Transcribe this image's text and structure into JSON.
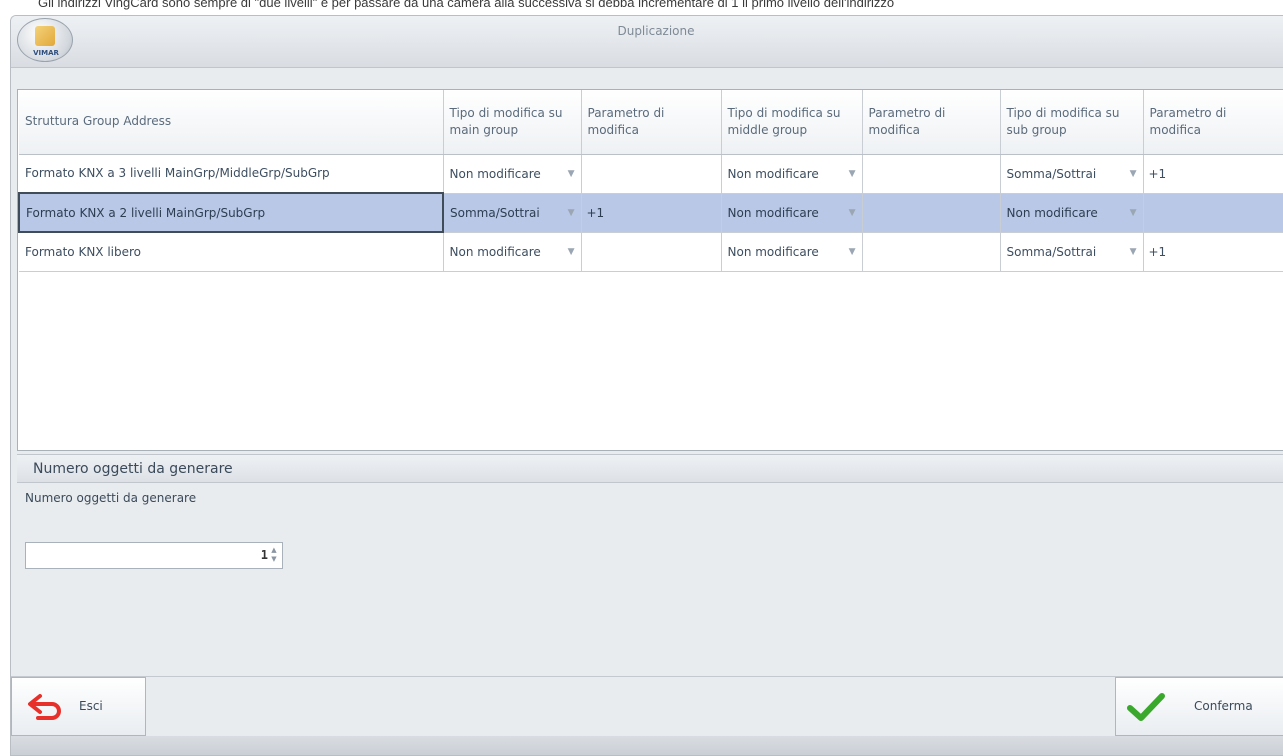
{
  "document_text": "Gli indirizzi VingCard sono sempre di \"due livelli\" e per passare da una camera alla successiva si debba incrementare di 1 il primo livello dell'indirizzo",
  "dialog": {
    "title": "Duplicazione",
    "logo_text": "VIMAR"
  },
  "table": {
    "headers": [
      "Struttura Group Address",
      "Tipo di modifica su main group",
      "Parametro di modifica",
      "Tipo di modifica su middle group",
      "Parametro di modifica",
      "Tipo di modifica su sub group",
      "Parametro di modifica"
    ],
    "rows": [
      {
        "structure": "Formato KNX a 3 livelli MainGrp/MiddleGrp/SubGrp",
        "main_type": "Non modificare",
        "main_param": "",
        "middle_type": "Non modificare",
        "middle_param": "",
        "sub_type": "Somma/Sottrai",
        "sub_param": "+1"
      },
      {
        "structure": "Formato KNX a 2 livelli MainGrp/SubGrp",
        "main_type": "Somma/Sottrai",
        "main_param": "+1",
        "middle_type": "Non modificare",
        "middle_param": "",
        "sub_type": "Non modificare",
        "sub_param": "",
        "selected": true
      },
      {
        "structure": "Formato KNX libero",
        "main_type": "Non modificare",
        "main_param": "",
        "middle_type": "Non modificare",
        "middle_param": "",
        "sub_type": "Somma/Sottrai",
        "sub_param": "+1"
      }
    ]
  },
  "objects_section": {
    "header": "Numero oggetti da generare",
    "field_label": "Numero oggetti da generare",
    "value": "1"
  },
  "buttons": {
    "exit_label": "Esci",
    "confirm_label": "Conferma"
  },
  "colors": {
    "selected_row": "#b8c8e6",
    "exit_icon": "#e8302a",
    "confirm_icon": "#3aa82c"
  }
}
